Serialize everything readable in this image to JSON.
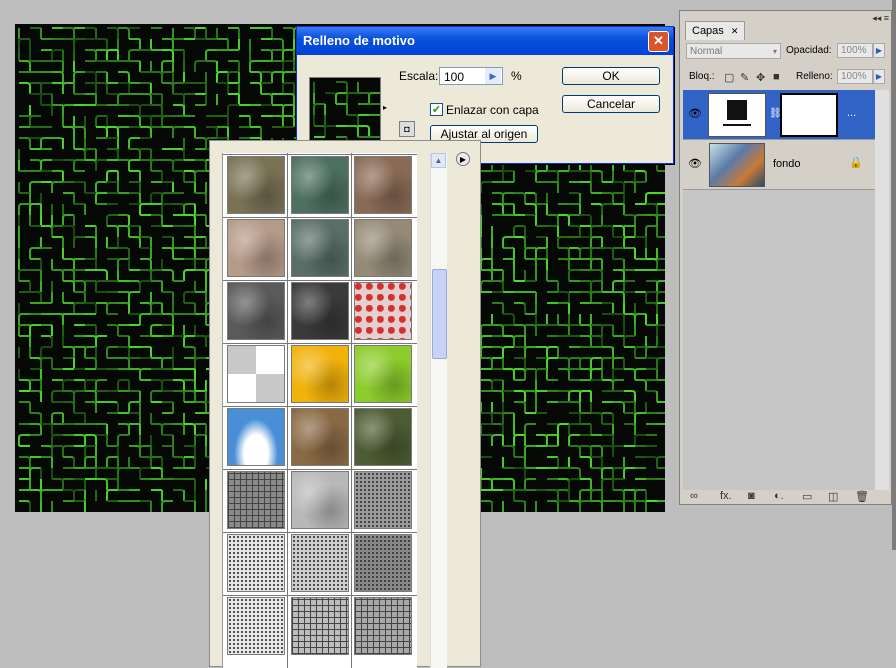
{
  "dialog": {
    "title": "Relleno de motivo",
    "close_symbol": "✕",
    "scale_label": "Escala:",
    "scale_value": "100",
    "percent": "%",
    "link_label": "Enlazar con capa",
    "link_checked": true,
    "snap_button": "Ajustar al origen",
    "ok_button": "OK",
    "cancel_button": "Cancelar"
  },
  "picker": {
    "pattern_rows": [
      [
        "clouds-brown",
        "clouds-green",
        "rock-brown"
      ],
      [
        "sand-pink",
        "stone-teal",
        "sand-grey"
      ],
      [
        "grey-fine",
        "dark-grey",
        "red-pills"
      ],
      [
        "checker-grey",
        "yellow-texture",
        "green-texture"
      ],
      [
        "blue-sky",
        "pebbles",
        "dark-moss"
      ],
      [
        "woven-grey",
        "light-grey",
        "noise-grey"
      ],
      [
        "fine-speckle",
        "sparse-speckle",
        "dense-speckle"
      ],
      [
        "light-paper",
        "grid-lines",
        "dense-lines"
      ]
    ],
    "colors": {
      "clouds-brown": "#7a7255",
      "clouds-green": "#4d7060",
      "rock-brown": "#8a6a55",
      "sand-pink": "#b59a88",
      "stone-teal": "#5a6e68",
      "sand-grey": "#948a76",
      "grey-fine": "#5a5a5a",
      "dark-grey": "#3a3a3a",
      "red-pills": "#e5d0d0",
      "checker-grey": "#dddddd",
      "yellow-texture": "#f2b20c",
      "green-texture": "#8ccc2c",
      "blue-sky": "#4a8ed8",
      "pebbles": "#8a6a45",
      "dark-moss": "#4d5c33",
      "woven-grey": "#8a8a8a",
      "light-grey": "#b8b8b8",
      "noise-grey": "#9a9a9a",
      "fine-speckle": "#e4e4e4",
      "sparse-speckle": "#cfcfcf",
      "dense-speckle": "#888888",
      "light-paper": "#e8e8e8",
      "grid-lines": "#bdbdbd",
      "dense-lines": "#a8a8a8"
    }
  },
  "layers_panel": {
    "tab_label": "Capas",
    "tab_close": "✕",
    "blend_mode": "Normal",
    "opacity_label": "Opacidad:",
    "opacity_value": "100%",
    "lock_label": "Bloq.:",
    "fill_label": "Relleno:",
    "fill_value": "100%",
    "layers": [
      {
        "name": "...",
        "selected": true
      },
      {
        "name": "fondo",
        "selected": false
      }
    ]
  }
}
